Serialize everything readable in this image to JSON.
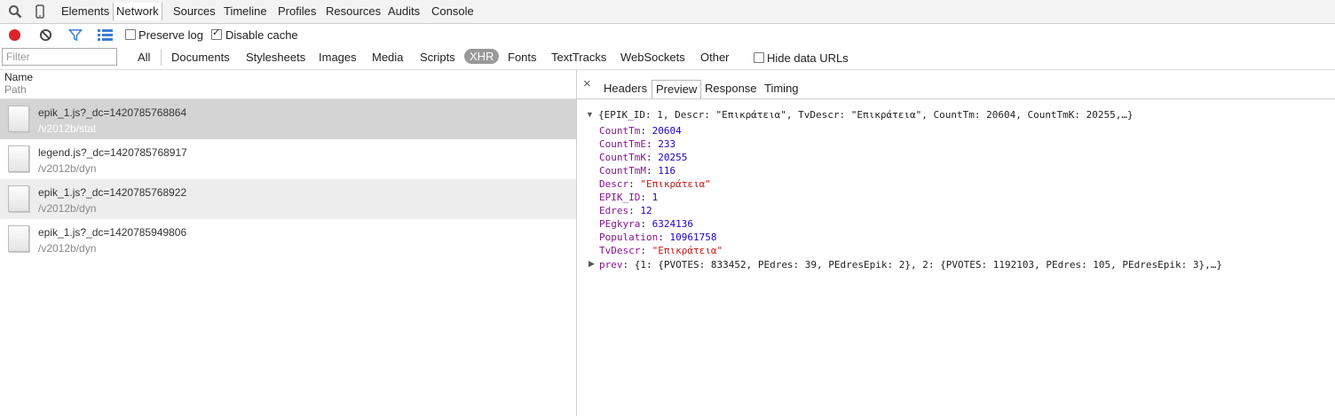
{
  "toolbar": {
    "tabs": [
      "Elements",
      "Network",
      "Sources",
      "Timeline",
      "Profiles",
      "Resources",
      "Audits",
      "Console"
    ],
    "active_tab": "Network"
  },
  "controls": {
    "preserve_log": "Preserve log",
    "preserve_log_checked": false,
    "disable_cache": "Disable cache",
    "disable_cache_checked": true
  },
  "filter": {
    "placeholder": "Filter",
    "types": [
      "All",
      "Documents",
      "Stylesheets",
      "Images",
      "Media",
      "Scripts",
      "XHR",
      "Fonts",
      "TextTracks",
      "WebSockets",
      "Other"
    ],
    "active_type": "XHR",
    "hide_data_urls": "Hide data URLs"
  },
  "columns": {
    "name": "Name",
    "path": "Path"
  },
  "requests": [
    {
      "name": "epik_1.js?_dc=1420785768864",
      "path": "/v2012b/stat"
    },
    {
      "name": "legend.js?_dc=1420785768917",
      "path": "/v2012b/dyn"
    },
    {
      "name": "epik_1.js?_dc=1420785768922",
      "path": "/v2012b/dyn"
    },
    {
      "name": "epik_1.js?_dc=1420785949806",
      "path": "/v2012b/dyn"
    }
  ],
  "detail": {
    "close": "×",
    "tabs": [
      "Headers",
      "Preview",
      "Response",
      "Timing"
    ],
    "active_tab": "Preview"
  },
  "preview": {
    "summary": "{EPIK_ID: 1, Descr: \"Επικράτεια\", TvDescr: \"Επικράτεια\", CountTm: 20604, CountTmK: 20255,…}",
    "fields": [
      {
        "key": "CountTm",
        "value": "20604",
        "kind": "num"
      },
      {
        "key": "CountTmE",
        "value": "233",
        "kind": "num"
      },
      {
        "key": "CountTmK",
        "value": "20255",
        "kind": "num"
      },
      {
        "key": "CountTmM",
        "value": "116",
        "kind": "num"
      },
      {
        "key": "Descr",
        "value": "\"Επικράτεια\"",
        "kind": "str"
      },
      {
        "key": "EPIK_ID",
        "value": "1",
        "kind": "num"
      },
      {
        "key": "Edres",
        "value": "12",
        "kind": "num"
      },
      {
        "key": "PEgkyra",
        "value": "6324136",
        "kind": "num"
      },
      {
        "key": "Population",
        "value": "10961758",
        "kind": "num"
      },
      {
        "key": "TvDescr",
        "value": "\"Επικράτεια\"",
        "kind": "str"
      }
    ],
    "prev_key": "prev",
    "prev_summary": "{1: {PVOTES: 833452, PEdres: 39, PEdresEpik: 2}, 2: {PVOTES: 1192103, PEdres: 105, PEdresEpik: 3},…}"
  },
  "colors": {
    "selected_row": "#d4d4d4",
    "record": "#d9262c",
    "filter_icon": "#3b7fd6"
  }
}
